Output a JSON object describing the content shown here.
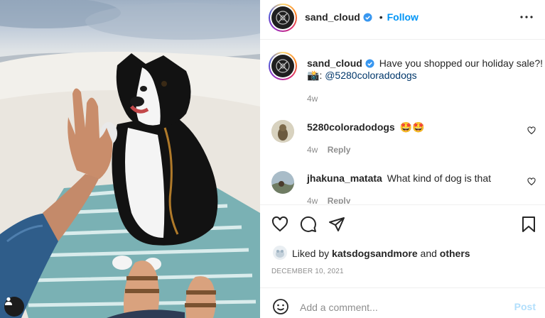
{
  "post": {
    "photo_alt": "",
    "tag_icon": "user-icon"
  },
  "header": {
    "username": "sand_cloud",
    "dot": "•",
    "follow_label": "Follow",
    "more_icon": "more-horizontal-icon"
  },
  "caption": {
    "username": "sand_cloud",
    "text": "Have you shopped our holiday sale?!",
    "camera_emoji": "📸",
    "mention": "@5280coloradodogs",
    "time": "4w"
  },
  "comments": [
    {
      "username": "5280coloradodogs",
      "text": "🤩🤩",
      "time": "4w",
      "reply_label": "Reply"
    },
    {
      "username": "jhakuna_matata",
      "text": "What kind of dog is that",
      "time": "4w",
      "reply_label": "Reply"
    }
  ],
  "actions": {
    "like_icon": "heart-icon",
    "comment_icon": "comment-icon",
    "share_icon": "paper-plane-icon",
    "save_icon": "bookmark-icon"
  },
  "likes": {
    "prefix": "Liked by",
    "user": "katsdogsandmore",
    "and": "and",
    "others": "others"
  },
  "date": "DECEMBER 10, 2021",
  "composer": {
    "placeholder": "Add a comment...",
    "post_label": "Post",
    "emoji_icon": "smiley-icon"
  },
  "colors": {
    "accent": "#0095f6",
    "verified": "#3897f0",
    "post_disabled": "#b2dffc"
  }
}
